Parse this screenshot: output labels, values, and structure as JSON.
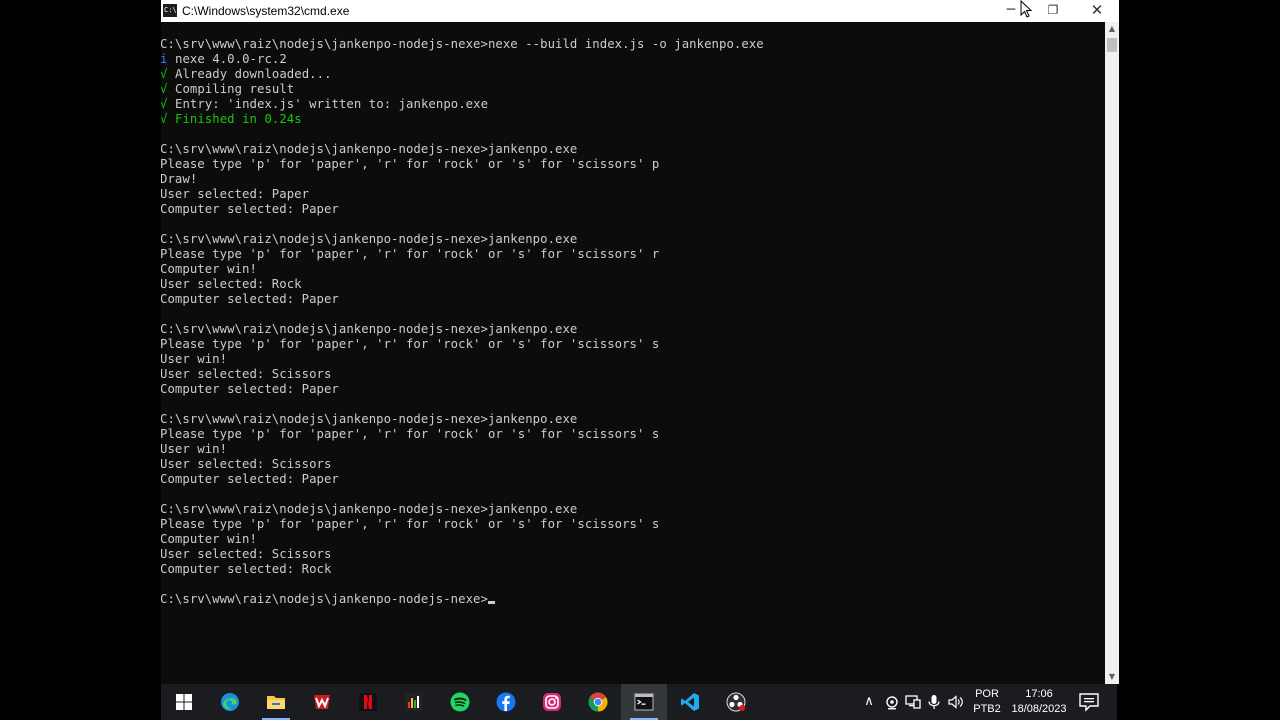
{
  "window": {
    "title": "C:\\Windows\\system32\\cmd.exe",
    "icon_label": "C:\\",
    "minimize": "─",
    "restore": "❐",
    "close": "✕"
  },
  "console": {
    "lines": [
      "",
      "C:\\srv\\www\\raiz\\nodejs\\jankenpo-nodejs-nexe>nexe --build index.js -o jankenpo.exe",
      "nexe 4.0.0-rc.2",
      "Already downloaded...",
      "Compiling result",
      "Entry: 'index.js' written to: jankenpo.exe",
      "Finished in 0.24s",
      "",
      "C:\\srv\\www\\raiz\\nodejs\\jankenpo-nodejs-nexe>jankenpo.exe",
      "Please type 'p' for 'paper', 'r' for 'rock' or 's' for 'scissors' p",
      "Draw!",
      "User selected: Paper",
      "Computer selected: Paper",
      "",
      "C:\\srv\\www\\raiz\\nodejs\\jankenpo-nodejs-nexe>jankenpo.exe",
      "Please type 'p' for 'paper', 'r' for 'rock' or 's' for 'scissors' r",
      "Computer win!",
      "User selected: Rock",
      "Computer selected: Paper",
      "",
      "C:\\srv\\www\\raiz\\nodejs\\jankenpo-nodejs-nexe>jankenpo.exe",
      "Please type 'p' for 'paper', 'r' for 'rock' or 's' for 'scissors' s",
      "User win!",
      "User selected: Scissors",
      "Computer selected: Paper",
      "",
      "C:\\srv\\www\\raiz\\nodejs\\jankenpo-nodejs-nexe>jankenpo.exe",
      "Please type 'p' for 'paper', 'r' for 'rock' or 's' for 'scissors' s",
      "User win!",
      "User selected: Scissors",
      "Computer selected: Paper",
      "",
      "C:\\srv\\www\\raiz\\nodejs\\jankenpo-nodejs-nexe>jankenpo.exe",
      "Please type 'p' for 'paper', 'r' for 'rock' or 's' for 'scissors' s",
      "Computer win!",
      "User selected: Scissors",
      "Computer selected: Rock",
      "",
      "C:\\srv\\www\\raiz\\nodejs\\jankenpo-nodejs-nexe>"
    ],
    "prefixes": {
      "2": {
        "glyph": "i",
        "kind": "info"
      },
      "3": {
        "glyph": "√",
        "kind": "ok"
      },
      "4": {
        "glyph": "√",
        "kind": "ok"
      },
      "5": {
        "glyph": "√",
        "kind": "ok"
      },
      "6": {
        "glyph": "√",
        "kind": "ok"
      }
    },
    "green_lines": [
      6
    ],
    "cursor_line": 38
  },
  "scrollbar": {
    "up": "▲",
    "down": "▼"
  },
  "taskbar": {
    "apps": [
      {
        "name": "start-button",
        "icon": "windows-icon"
      },
      {
        "name": "edge-app",
        "icon": "edge-icon"
      },
      {
        "name": "file-explorer-app",
        "icon": "folder-icon"
      },
      {
        "name": "winrar-app",
        "icon": "winrar-icon"
      },
      {
        "name": "netflix-app",
        "icon": "netflix-icon"
      },
      {
        "name": "app-6",
        "icon": "equalizer-icon"
      },
      {
        "name": "spotify-app",
        "icon": "spotify-icon"
      },
      {
        "name": "facebook-app",
        "icon": "facebook-icon"
      },
      {
        "name": "instagram-app",
        "icon": "instagram-icon"
      },
      {
        "name": "chrome-app",
        "icon": "chrome-icon"
      },
      {
        "name": "cmd-app",
        "icon": "cmd-icon"
      },
      {
        "name": "vscode-app",
        "icon": "vscode-icon"
      },
      {
        "name": "obs-app",
        "icon": "obs-icon"
      }
    ],
    "tray": {
      "chevron": "∧",
      "language": "POR",
      "keyboard": "PTB2",
      "time": "17:06",
      "date": "18/08/2023"
    }
  },
  "colors": {
    "console_bg": "#0c0c0c",
    "console_text": "#cccccc",
    "ok_green": "#16c60c",
    "info_blue": "#3b78ff",
    "taskbar_bg": "#1a1c1f"
  }
}
